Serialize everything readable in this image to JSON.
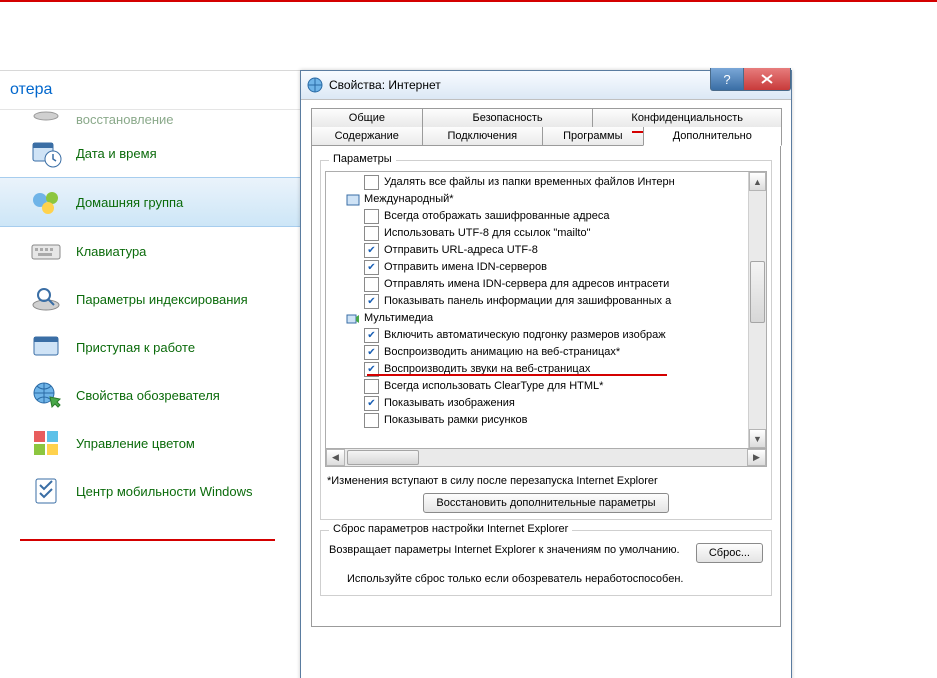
{
  "cp": {
    "header": "отера",
    "items": [
      {
        "label": "восстановление"
      },
      {
        "label": "Дата и время"
      },
      {
        "label": "Домашняя группа"
      },
      {
        "label": "Клавиатура"
      },
      {
        "label": "Параметры индексирования"
      },
      {
        "label": "Приступая к работе"
      },
      {
        "label": "Свойства обозревателя"
      },
      {
        "label": "Управление цветом"
      },
      {
        "label": "Центр мобильности Windows"
      }
    ]
  },
  "dlg": {
    "title": "Свойства: Интернет",
    "tabs_row1": [
      "Общие",
      "Безопасность",
      "Конфиденциальность"
    ],
    "tabs_row2": [
      "Содержание",
      "Подключения",
      "Программы",
      "Дополнительно"
    ],
    "group_title": "Параметры",
    "tree": {
      "r0": "Удалять все файлы из папки временных файлов Интерн",
      "cat1": "Международный*",
      "r1": "Всегда отображать зашифрованные адреса",
      "r2": "Использовать UTF-8 для ссылок \"mailto\"",
      "r3": "Отправить URL-адреса UTF-8",
      "r4": "Отправить имена IDN-серверов",
      "r5": "Отправлять имена IDN-сервера для адресов интрасети",
      "r6": "Показывать панель информации для зашифрованных а",
      "cat2": "Мультимедиа",
      "r7": "Включить автоматическую подгонку размеров изображ",
      "r8": "Воспроизводить анимацию на веб-страницах*",
      "r9": "Воспроизводить звуки на веб-страницах",
      "r10": "Всегда использовать ClearType для HTML*",
      "r11": "Показывать изображения",
      "r12": "Показывать рамки рисунков"
    },
    "restart_note": "*Изменения вступают в силу после перезапуска Internet Explorer",
    "restore_btn": "Восстановить дополнительные параметры",
    "reset_group_title": "Сброс параметров настройки Internet Explorer",
    "reset_text": "Возвращает параметры Internet Explorer к значениям по умолчанию.",
    "reset_btn": "Сброс...",
    "reset_hint": "Используйте сброс только если обозреватель неработоспособен."
  }
}
